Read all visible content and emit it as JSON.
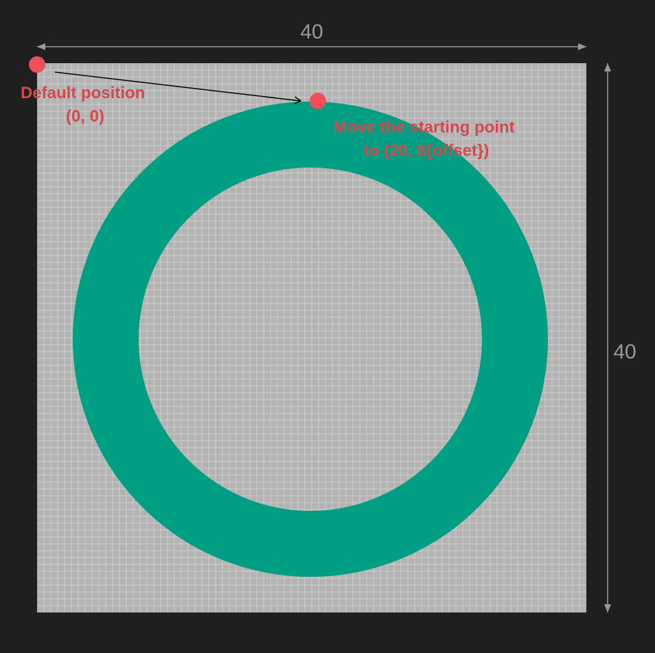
{
  "dimensions": {
    "width_label": "40",
    "height_label": "40"
  },
  "annotations": {
    "default_position": {
      "line1": "Default position",
      "line2": "(0, 0)"
    },
    "new_position": {
      "line1": "Move the starting point",
      "line2": "to (20, ${offset})"
    }
  },
  "colors": {
    "background": "#1f1f1f",
    "canvas": "#b3b3b3",
    "grid_line": "#cfcfcf",
    "ring": "#009e82",
    "marker": "#ef4f5a",
    "label": "#d6474f",
    "dimension_line": "#9a9a9a",
    "dimension_text": "#9a9a9a",
    "arrow": "#000000"
  }
}
